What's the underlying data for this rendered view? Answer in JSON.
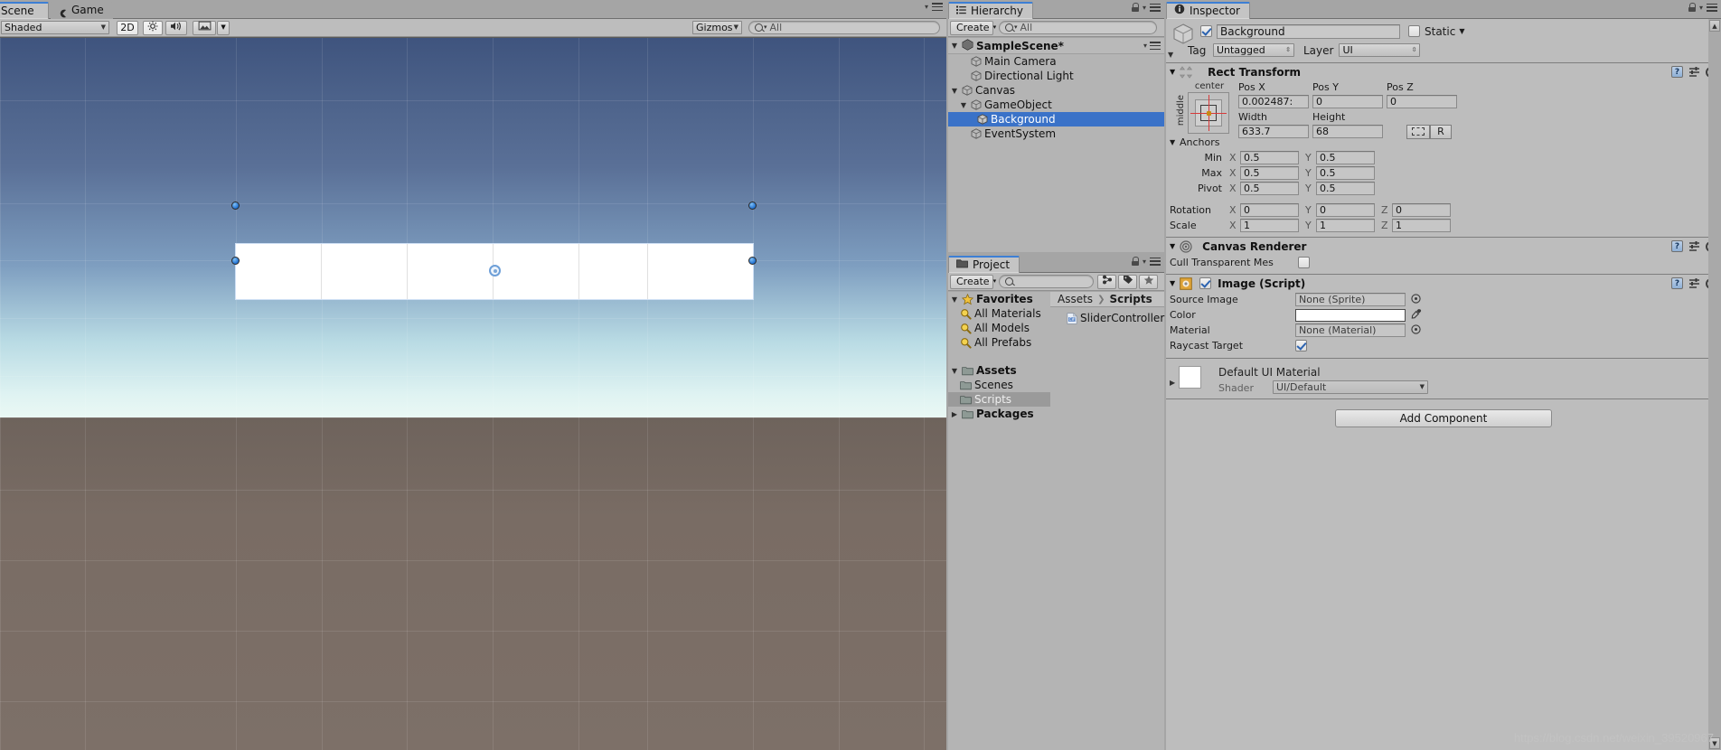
{
  "app": "Unity Editor",
  "scene_view": {
    "tabs": [
      {
        "label": "Scene",
        "icon": "scene-icon",
        "active": true
      },
      {
        "label": "Game",
        "icon": "game-icon",
        "active": false
      }
    ],
    "toolbar": {
      "draw_mode": "Shaded",
      "two_d_toggle": "2D",
      "lighting_icon": "sun-icon",
      "audio_icon": "speaker-icon",
      "fx_icon": "image-icon",
      "gizmos_label": "Gizmos",
      "search_placeholder": "All",
      "search_value": "All"
    },
    "selection": {
      "handle_count": 4,
      "center_gizmo": "move-tool-gizmo"
    }
  },
  "hierarchy": {
    "title": "Hierarchy",
    "create_label": "Create",
    "search_value": "All",
    "scene_name": "SampleScene*",
    "items": [
      {
        "label": "Main Camera",
        "depth": 1,
        "fold": "",
        "selected": false
      },
      {
        "label": "Directional Light",
        "depth": 1,
        "fold": "",
        "selected": false
      },
      {
        "label": "Canvas",
        "depth": 1,
        "fold": "▼",
        "selected": false
      },
      {
        "label": "GameObject",
        "depth": 2,
        "fold": "▼",
        "selected": false
      },
      {
        "label": "Background",
        "depth": 3,
        "fold": "",
        "selected": true
      },
      {
        "label": "EventSystem",
        "depth": 1,
        "fold": "",
        "selected": false
      }
    ]
  },
  "project": {
    "title": "Project",
    "create_label": "Create",
    "search_value": "",
    "breadcrumb": [
      "Assets",
      "Scripts"
    ],
    "tree": [
      {
        "label": "Favorites",
        "type": "star",
        "bold": true,
        "depth": 0,
        "fold": "▼",
        "selected": false
      },
      {
        "label": "All Materials",
        "type": "search",
        "bold": false,
        "depth": 1,
        "fold": "",
        "selected": false
      },
      {
        "label": "All Models",
        "type": "search",
        "bold": false,
        "depth": 1,
        "fold": "",
        "selected": false
      },
      {
        "label": "All Prefabs",
        "type": "search",
        "bold": false,
        "depth": 1,
        "fold": "",
        "selected": false
      },
      {
        "label": "Assets",
        "type": "folder",
        "bold": true,
        "depth": 0,
        "fold": "▼",
        "selected": false
      },
      {
        "label": "Scenes",
        "type": "folder",
        "bold": false,
        "depth": 1,
        "fold": "",
        "selected": false
      },
      {
        "label": "Scripts",
        "type": "folder",
        "bold": false,
        "depth": 1,
        "fold": "",
        "selected": true
      },
      {
        "label": "Packages",
        "type": "folder",
        "bold": true,
        "depth": 0,
        "fold": "▶",
        "selected": false
      }
    ],
    "files": [
      {
        "label": "SliderController",
        "type": "cs-script"
      }
    ]
  },
  "inspector": {
    "title": "Inspector",
    "object_name": "Background",
    "enabled": true,
    "static_label": "Static",
    "static_checked": false,
    "tag_label": "Tag",
    "tag_value": "Untagged",
    "layer_label": "Layer",
    "layer_value": "UI",
    "rect_transform": {
      "title": "Rect Transform",
      "anchor_preset_top": "center",
      "anchor_preset_side": "middle",
      "pos_x_label": "Pos X",
      "pos_x": "0.002487:",
      "pos_y_label": "Pos Y",
      "pos_y": "0",
      "pos_z_label": "Pos Z",
      "pos_z": "0",
      "width_label": "Width",
      "width": "633.7",
      "height_label": "Height",
      "height": "68",
      "blueprint_label": "R",
      "anchors_label": "Anchors",
      "min_label": "Min",
      "min_x": "0.5",
      "min_y": "0.5",
      "max_label": "Max",
      "max_x": "0.5",
      "max_y": "0.5",
      "pivot_label": "Pivot",
      "pivot_x": "0.5",
      "pivot_y": "0.5",
      "rotation_label": "Rotation",
      "rot_x": "0",
      "rot_y": "0",
      "rot_z": "0",
      "scale_label": "Scale",
      "scale_x": "1",
      "scale_y": "1",
      "scale_z": "1",
      "axis_x": "X",
      "axis_y": "Y",
      "axis_z": "Z"
    },
    "canvas_renderer": {
      "title": "Canvas Renderer",
      "cull_label": "Cull Transparent Mes",
      "cull_checked": false
    },
    "image_script": {
      "title": "Image (Script)",
      "enabled": true,
      "source_image_label": "Source Image",
      "source_image_value": "None (Sprite)",
      "color_label": "Color",
      "color_value": "#FFFFFF",
      "material_label": "Material",
      "material_value": "None (Material)",
      "raycast_label": "Raycast Target",
      "raycast_checked": true
    },
    "material_preview": {
      "name": "Default UI Material",
      "shader_label": "Shader",
      "shader_value": "UI/Default"
    },
    "add_component_label": "Add Component"
  },
  "watermark": "https://blog.csdn.net/weixin_39520967",
  "colors": {
    "selection_blue": "#3a72c8",
    "chrome_gray": "#a5a5a5",
    "panel_gray": "#bdbdbd",
    "tab_active": "#c4c4c4"
  }
}
